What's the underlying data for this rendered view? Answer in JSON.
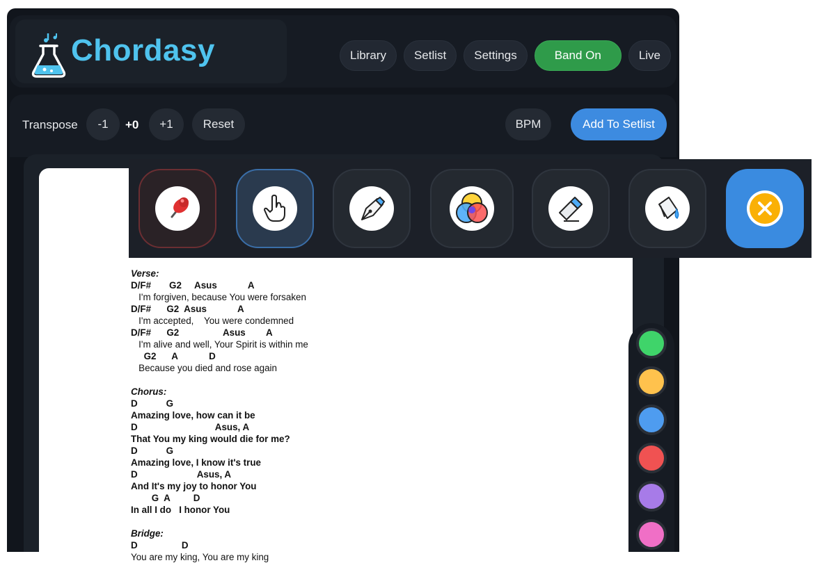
{
  "app": {
    "brand": "Chordasy"
  },
  "nav": [
    {
      "label": "Library"
    },
    {
      "label": "Setlist"
    },
    {
      "label": "Settings"
    },
    {
      "label": "Band On",
      "active": true
    },
    {
      "label": "Live"
    }
  ],
  "transpose": {
    "label": "Transpose",
    "minus": "-1",
    "value": "+0",
    "plus": "+1",
    "reset": "Reset"
  },
  "bpm_label": "BPM",
  "add_setlist_label": "Add To Setlist",
  "tools": [
    {
      "name": "pin-icon"
    },
    {
      "name": "hand-pointer-icon"
    },
    {
      "name": "pen-icon"
    },
    {
      "name": "color-mix-icon"
    },
    {
      "name": "eraser-icon"
    },
    {
      "name": "paint-bucket-icon"
    },
    {
      "name": "close-icon"
    }
  ],
  "palette": [
    "#3fd46a",
    "#ffc24d",
    "#4e9cf0",
    "#f05252",
    "#a77be8",
    "#f06fc6"
  ],
  "lyrics": {
    "verse_title": "Verse:",
    "verse": [
      {
        "t": "chord",
        "text": "D/F#       G2     Asus            A"
      },
      {
        "t": "lyric",
        "text": "   I'm forgiven, because You were forsaken"
      },
      {
        "t": "chord",
        "text": "D/F#      G2  Asus            A"
      },
      {
        "t": "lyric",
        "text": "   I'm accepted,    You were condemned"
      },
      {
        "t": "chord",
        "text": "D/F#      G2                 Asus        A"
      },
      {
        "t": "lyric",
        "text": "   I'm alive and well, Your Spirit is within me"
      },
      {
        "t": "chord",
        "text": "     G2      A            D"
      },
      {
        "t": "lyric",
        "text": "   Because you died and rose again"
      }
    ],
    "chorus_title": "Chorus:",
    "chorus": [
      {
        "t": "chord",
        "text": "D           G"
      },
      {
        "t": "bold",
        "text": "Amazing love, how can it be"
      },
      {
        "t": "chord",
        "text": "D                              Asus, A"
      },
      {
        "t": "bold",
        "text": "That You my king would die for me?"
      },
      {
        "t": "chord",
        "text": "D           G"
      },
      {
        "t": "bold",
        "text": "Amazing love, I know it's true"
      },
      {
        "t": "chord",
        "text": "D                       Asus, A"
      },
      {
        "t": "bold",
        "text": "And It's my joy to honor You"
      },
      {
        "t": "chord",
        "text": "        G  A         D"
      },
      {
        "t": "bold",
        "text": "In all I do   I honor You"
      }
    ],
    "bridge_title": "Bridge:",
    "bridge": [
      {
        "t": "chord",
        "text": "D                 D"
      },
      {
        "t": "lyric",
        "text": "You are my king, You are my king"
      }
    ]
  }
}
